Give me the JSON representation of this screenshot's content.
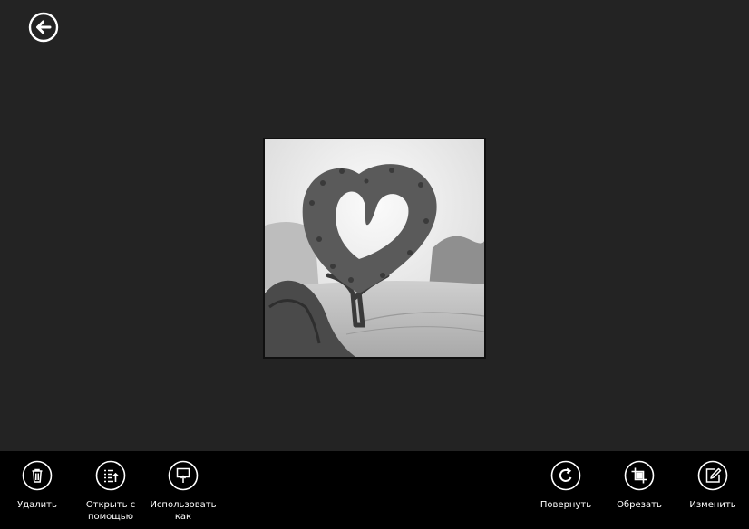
{
  "viewer": {
    "back_icon": "back-arrow-icon",
    "photo_description": "heart-shaped-tree"
  },
  "appbar": {
    "left_commands": [
      {
        "label": "Удалить",
        "icon": "trash-icon"
      },
      {
        "label": "Открыть с помощью",
        "icon": "open-with-icon"
      },
      {
        "label": "Использовать как",
        "icon": "set-as-icon"
      }
    ],
    "right_commands": [
      {
        "label": "Повернуть",
        "icon": "rotate-icon"
      },
      {
        "label": "Обрезать",
        "icon": "crop-icon"
      },
      {
        "label": "Изменить",
        "icon": "edit-icon"
      }
    ]
  },
  "colors": {
    "background": "#232323",
    "appbar": "#000000",
    "foreground": "#ffffff"
  }
}
